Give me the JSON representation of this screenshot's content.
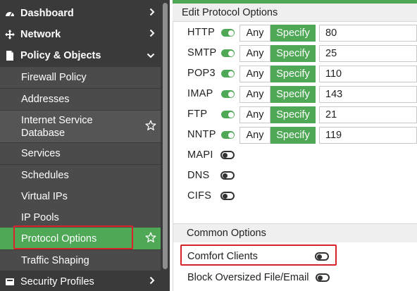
{
  "sidebar": {
    "top_items": [
      {
        "label": "Dashboard",
        "icon": "dashboard-icon",
        "chevron": "right"
      },
      {
        "label": "Network",
        "icon": "network-move-icon",
        "chevron": "right"
      },
      {
        "label": "Policy & Objects",
        "icon": "policy-document-icon",
        "chevron": "down"
      }
    ],
    "sub_items": [
      {
        "label": "Firewall Policy"
      },
      {
        "label": "Addresses"
      },
      {
        "label": "Internet Service Database",
        "lines": [
          "Internet Service",
          "Database"
        ],
        "starred": true
      },
      {
        "label": "Services"
      },
      {
        "label": "Schedules"
      },
      {
        "label": "Virtual IPs"
      },
      {
        "label": "IP Pools"
      },
      {
        "label": "Protocol Options",
        "active": true,
        "starred": true
      },
      {
        "label": "Traffic Shaping"
      }
    ],
    "bottom_item": {
      "label": "Security Profiles",
      "icon": "security-profiles-icon",
      "chevron": "right"
    }
  },
  "panel": {
    "title": "Edit Protocol Options",
    "any_label": "Any",
    "specify_label": "Specify",
    "protocols": [
      {
        "name": "HTTP",
        "enabled": true,
        "port": "80"
      },
      {
        "name": "SMTP",
        "enabled": true,
        "port": "25"
      },
      {
        "name": "POP3",
        "enabled": true,
        "port": "110"
      },
      {
        "name": "IMAP",
        "enabled": true,
        "port": "143"
      },
      {
        "name": "FTP",
        "enabled": true,
        "port": "21"
      },
      {
        "name": "NNTP",
        "enabled": true,
        "port": "119"
      },
      {
        "name": "MAPI",
        "enabled": false
      },
      {
        "name": "DNS",
        "enabled": false
      },
      {
        "name": "CIFS",
        "enabled": false
      }
    ],
    "common_options": {
      "title": "Common Options",
      "options": [
        {
          "label": "Comfort Clients",
          "enabled": false
        },
        {
          "label": "Block Oversized File/Email",
          "enabled": false
        }
      ]
    }
  },
  "colors": {
    "accent_green": "#4ea856",
    "sidebar_bg": "#3a3a3a",
    "highlight_red": "#d9232a"
  }
}
